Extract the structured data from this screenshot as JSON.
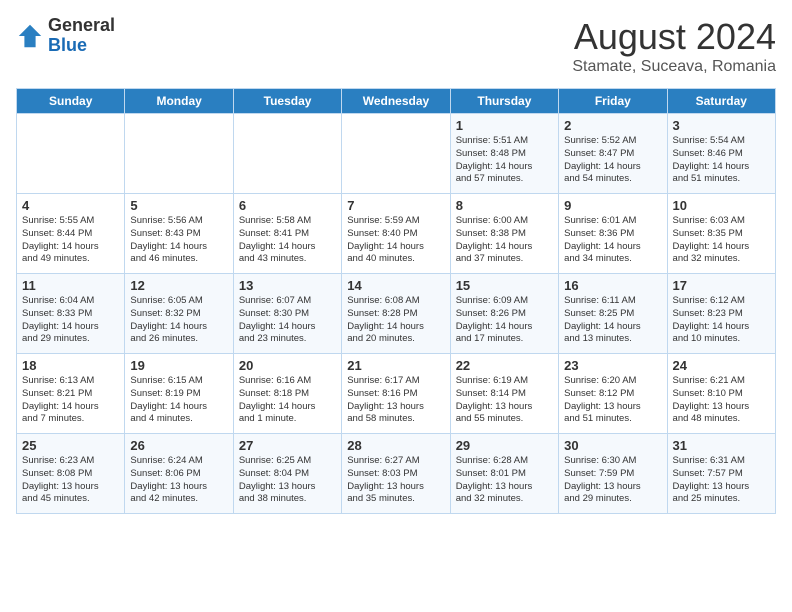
{
  "header": {
    "logo_general": "General",
    "logo_blue": "Blue",
    "month_year": "August 2024",
    "location": "Stamate, Suceava, Romania"
  },
  "weekdays": [
    "Sunday",
    "Monday",
    "Tuesday",
    "Wednesday",
    "Thursday",
    "Friday",
    "Saturday"
  ],
  "weeks": [
    [
      {
        "day": "",
        "info": ""
      },
      {
        "day": "",
        "info": ""
      },
      {
        "day": "",
        "info": ""
      },
      {
        "day": "",
        "info": ""
      },
      {
        "day": "1",
        "info": "Sunrise: 5:51 AM\nSunset: 8:48 PM\nDaylight: 14 hours\nand 57 minutes."
      },
      {
        "day": "2",
        "info": "Sunrise: 5:52 AM\nSunset: 8:47 PM\nDaylight: 14 hours\nand 54 minutes."
      },
      {
        "day": "3",
        "info": "Sunrise: 5:54 AM\nSunset: 8:46 PM\nDaylight: 14 hours\nand 51 minutes."
      }
    ],
    [
      {
        "day": "4",
        "info": "Sunrise: 5:55 AM\nSunset: 8:44 PM\nDaylight: 14 hours\nand 49 minutes."
      },
      {
        "day": "5",
        "info": "Sunrise: 5:56 AM\nSunset: 8:43 PM\nDaylight: 14 hours\nand 46 minutes."
      },
      {
        "day": "6",
        "info": "Sunrise: 5:58 AM\nSunset: 8:41 PM\nDaylight: 14 hours\nand 43 minutes."
      },
      {
        "day": "7",
        "info": "Sunrise: 5:59 AM\nSunset: 8:40 PM\nDaylight: 14 hours\nand 40 minutes."
      },
      {
        "day": "8",
        "info": "Sunrise: 6:00 AM\nSunset: 8:38 PM\nDaylight: 14 hours\nand 37 minutes."
      },
      {
        "day": "9",
        "info": "Sunrise: 6:01 AM\nSunset: 8:36 PM\nDaylight: 14 hours\nand 34 minutes."
      },
      {
        "day": "10",
        "info": "Sunrise: 6:03 AM\nSunset: 8:35 PM\nDaylight: 14 hours\nand 32 minutes."
      }
    ],
    [
      {
        "day": "11",
        "info": "Sunrise: 6:04 AM\nSunset: 8:33 PM\nDaylight: 14 hours\nand 29 minutes."
      },
      {
        "day": "12",
        "info": "Sunrise: 6:05 AM\nSunset: 8:32 PM\nDaylight: 14 hours\nand 26 minutes."
      },
      {
        "day": "13",
        "info": "Sunrise: 6:07 AM\nSunset: 8:30 PM\nDaylight: 14 hours\nand 23 minutes."
      },
      {
        "day": "14",
        "info": "Sunrise: 6:08 AM\nSunset: 8:28 PM\nDaylight: 14 hours\nand 20 minutes."
      },
      {
        "day": "15",
        "info": "Sunrise: 6:09 AM\nSunset: 8:26 PM\nDaylight: 14 hours\nand 17 minutes."
      },
      {
        "day": "16",
        "info": "Sunrise: 6:11 AM\nSunset: 8:25 PM\nDaylight: 14 hours\nand 13 minutes."
      },
      {
        "day": "17",
        "info": "Sunrise: 6:12 AM\nSunset: 8:23 PM\nDaylight: 14 hours\nand 10 minutes."
      }
    ],
    [
      {
        "day": "18",
        "info": "Sunrise: 6:13 AM\nSunset: 8:21 PM\nDaylight: 14 hours\nand 7 minutes."
      },
      {
        "day": "19",
        "info": "Sunrise: 6:15 AM\nSunset: 8:19 PM\nDaylight: 14 hours\nand 4 minutes."
      },
      {
        "day": "20",
        "info": "Sunrise: 6:16 AM\nSunset: 8:18 PM\nDaylight: 14 hours\nand 1 minute."
      },
      {
        "day": "21",
        "info": "Sunrise: 6:17 AM\nSunset: 8:16 PM\nDaylight: 13 hours\nand 58 minutes."
      },
      {
        "day": "22",
        "info": "Sunrise: 6:19 AM\nSunset: 8:14 PM\nDaylight: 13 hours\nand 55 minutes."
      },
      {
        "day": "23",
        "info": "Sunrise: 6:20 AM\nSunset: 8:12 PM\nDaylight: 13 hours\nand 51 minutes."
      },
      {
        "day": "24",
        "info": "Sunrise: 6:21 AM\nSunset: 8:10 PM\nDaylight: 13 hours\nand 48 minutes."
      }
    ],
    [
      {
        "day": "25",
        "info": "Sunrise: 6:23 AM\nSunset: 8:08 PM\nDaylight: 13 hours\nand 45 minutes."
      },
      {
        "day": "26",
        "info": "Sunrise: 6:24 AM\nSunset: 8:06 PM\nDaylight: 13 hours\nand 42 minutes."
      },
      {
        "day": "27",
        "info": "Sunrise: 6:25 AM\nSunset: 8:04 PM\nDaylight: 13 hours\nand 38 minutes."
      },
      {
        "day": "28",
        "info": "Sunrise: 6:27 AM\nSunset: 8:03 PM\nDaylight: 13 hours\nand 35 minutes."
      },
      {
        "day": "29",
        "info": "Sunrise: 6:28 AM\nSunset: 8:01 PM\nDaylight: 13 hours\nand 32 minutes."
      },
      {
        "day": "30",
        "info": "Sunrise: 6:30 AM\nSunset: 7:59 PM\nDaylight: 13 hours\nand 29 minutes."
      },
      {
        "day": "31",
        "info": "Sunrise: 6:31 AM\nSunset: 7:57 PM\nDaylight: 13 hours\nand 25 minutes."
      }
    ]
  ]
}
